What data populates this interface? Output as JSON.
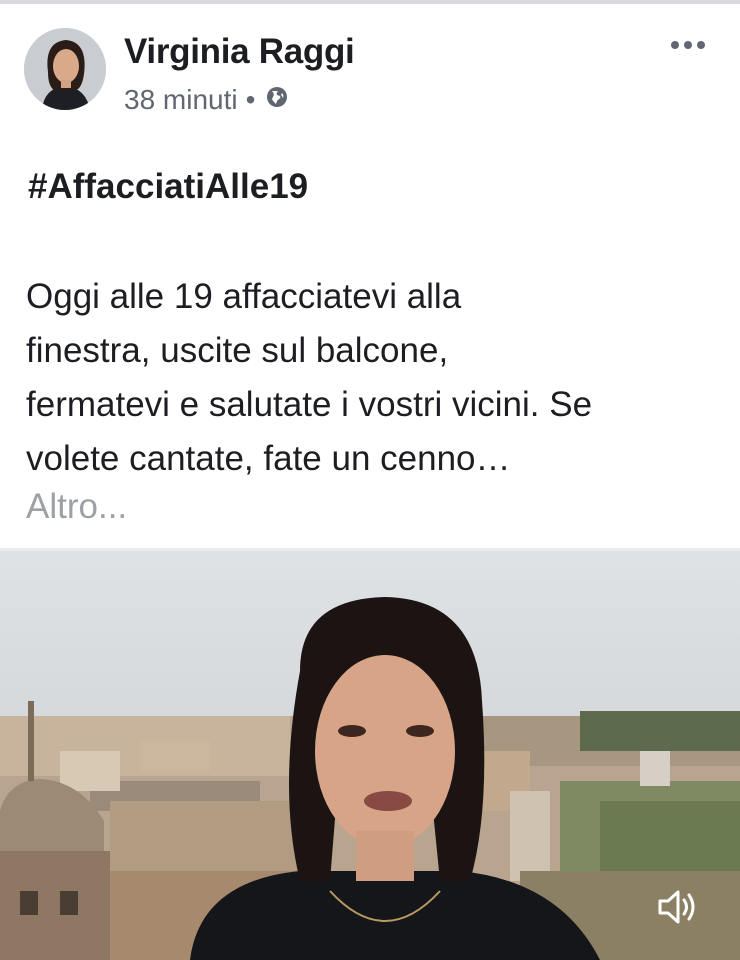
{
  "post": {
    "author": "Virginia Raggi",
    "time": "38 minuti",
    "separator": "•",
    "privacy_icon": "globe-icon",
    "more_icon": "more-options-icon",
    "hashtag": "#AffacciatiAlle19",
    "body_lines": [
      "Oggi alle 19 affacciatevi alla",
      "finestra, uscite sul balcone,",
      "fermatevi e salutate i vostri vicini. Se",
      "volete cantate, fate un cenno…"
    ],
    "see_more": "Altro...",
    "video": {
      "volume_icon": "volume-icon"
    }
  },
  "colors": {
    "text": "#1c1e21",
    "meta": "#606770",
    "muted": "#9da1a6"
  }
}
